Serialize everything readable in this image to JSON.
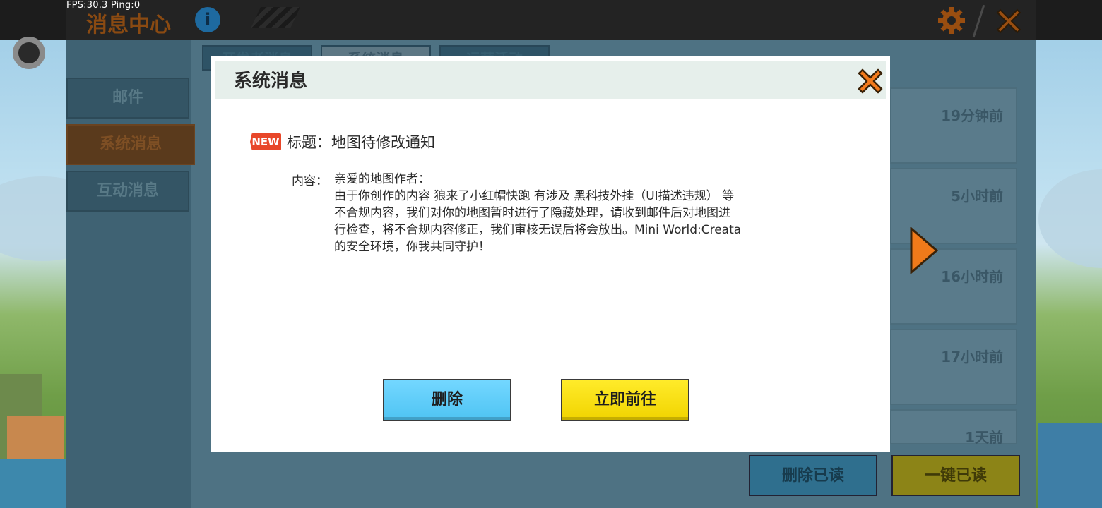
{
  "status": {
    "fps": "FPS:30.3  Ping:0"
  },
  "header": {
    "title": "消息中心",
    "info_icon": "i"
  },
  "colors": {
    "accent_orange": "#f07a1a",
    "dialog_blue": "#55c8f5",
    "dialog_yellow": "#f5dc00",
    "new_badge": "#e8472a"
  },
  "icons": [
    "info-icon",
    "gear-icon",
    "close-icon",
    "record-icon",
    "chevron-right-icon"
  ],
  "sidebar": {
    "items": [
      {
        "label": "邮件"
      },
      {
        "label": "系统消息"
      },
      {
        "label": "互动消息"
      }
    ]
  },
  "tabs": [
    {
      "label": "开发者消息"
    },
    {
      "label": "系统消息"
    },
    {
      "label": "运营活动"
    }
  ],
  "messages": [
    {
      "time": "19分钟前"
    },
    {
      "time": "5小时前"
    },
    {
      "time": "16小时前"
    },
    {
      "time": "17小时前"
    },
    {
      "time": "1天前"
    }
  ],
  "footer": {
    "delete_read": "删除已读",
    "mark_all_read": "一键已读"
  },
  "dialog": {
    "title": "系统消息",
    "new_badge": "NEW",
    "headline": "标题：地图待修改通知",
    "content_label": "内容：",
    "content_lines": [
      "亲爱的地图作者：",
      "由于你创作的内容 狼来了小红帽快跑 有涉及 黑科技外挂（UI描述违规） 等",
      "不合规内容，我们对你的地图暂时进行了隐藏处理，请收到邮件后对地图进",
      "行检查，将不合规内容修正，我们审核无误后将会放出。Mini World:Creata",
      "的安全环境，你我共同守护！"
    ],
    "delete_button": "删除",
    "goto_button": "立即前往"
  }
}
